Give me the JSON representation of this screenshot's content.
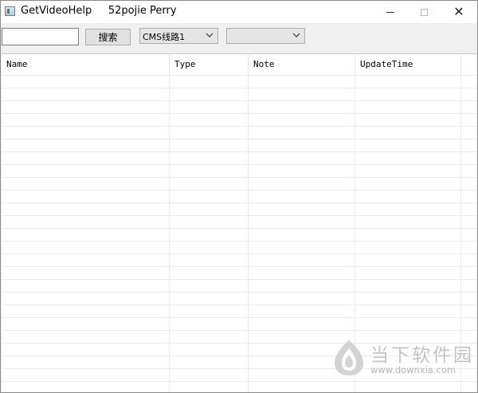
{
  "window": {
    "title": "GetVideoHelp     52pojie Perry",
    "close_glyph": "✕"
  },
  "toolbar": {
    "search_value": "",
    "search_label": "搜索",
    "source_selected": "CMS线路1",
    "type_selected": ""
  },
  "table": {
    "columns": [
      "Name",
      "Type",
      "Note",
      "UpdateTime"
    ],
    "rows": []
  },
  "watermark": {
    "brand": "当下软件园",
    "url": "www.downxia.com"
  },
  "icons": {
    "app": "app-window-icon",
    "minimize": "minimize-icon",
    "maximize": "maximize-icon",
    "close": "close-icon",
    "dropdown": "chevron-down-icon",
    "watermark_logo": "downxia-logo-icon"
  },
  "colors": {
    "window_bg": "#f0f0f0",
    "grid_line": "#ececec",
    "watermark": "#c4c4c4"
  }
}
